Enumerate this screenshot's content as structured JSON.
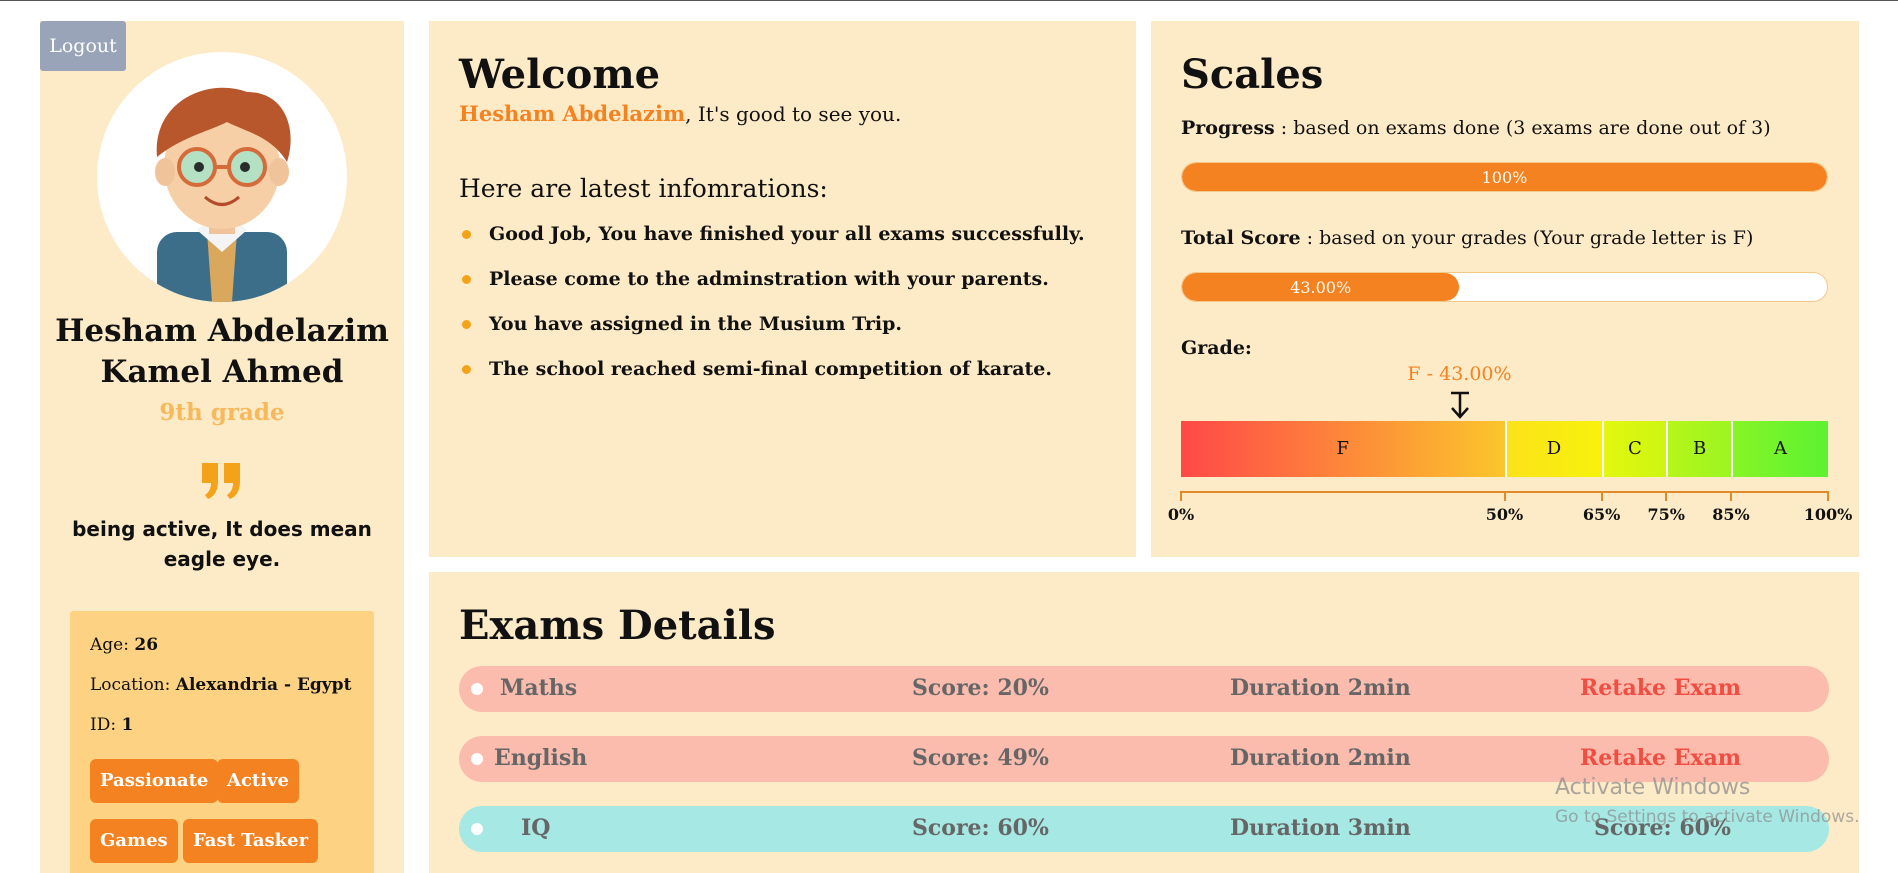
{
  "sidebar": {
    "logout_label": "Logout",
    "name": "Hesham Abdelazim Kamel Ahmed",
    "grade_level": "9th grade",
    "quote": "being active, It does mean eagle eye.",
    "info": {
      "age_label": "Age:",
      "age": "26",
      "location_label": "Location:",
      "location": "Alexandria - Egypt",
      "id_label": "ID:",
      "id": "1"
    },
    "tags": [
      "Passionate",
      "Active",
      "Games",
      "Fast Tasker"
    ]
  },
  "welcome": {
    "title": "Welcome",
    "name": "Hesham Abdelazim",
    "greeting": ", It's good to see you.",
    "subtitle": "Here are latest infomrations:",
    "items": [
      "Good Job, You have finished your all exams successfully.",
      "Please come to the adminstration with your parents.",
      "You have assigned in the Musium Trip.",
      "The school reached semi-final competition of karate."
    ]
  },
  "scales": {
    "title": "Scales",
    "progress_label": "Progress",
    "progress_desc": " : based on exams done (3 exams are done out of 3)",
    "progress_value": 100,
    "progress_text": "100%",
    "score_label": "Total Score",
    "score_desc": " : based on your grades (Your grade letter is F)",
    "score_value": 43,
    "score_text": "43.00%",
    "grade_label": "Grade:",
    "marker_text": "F - 43.00%",
    "segments": [
      {
        "letter": "F",
        "from": 0,
        "to": 50
      },
      {
        "letter": "D",
        "from": 50,
        "to": 65
      },
      {
        "letter": "C",
        "from": 65,
        "to": 75
      },
      {
        "letter": "B",
        "from": 75,
        "to": 85
      },
      {
        "letter": "A",
        "from": 85,
        "to": 100
      }
    ],
    "ticks": [
      "0%",
      "50%",
      "65%",
      "75%",
      "85%",
      "100%"
    ],
    "tick_values": [
      0,
      50,
      65,
      75,
      85,
      100
    ]
  },
  "exams": {
    "title": "Exams Details",
    "rows": [
      {
        "name": "Maths",
        "score": "Score: 20%",
        "duration": "Duration 2min",
        "action": "Retake Exam",
        "status": "fail",
        "color": "#fbbcae"
      },
      {
        "name": "English",
        "score": "Score: 49%",
        "duration": "Duration 2min",
        "action": "Retake Exam",
        "status": "fail",
        "color": "#fbbcae"
      },
      {
        "name": "IQ",
        "score": "Score: 60%",
        "duration": "Duration 3min",
        "action": "Score: 60%",
        "status": "pass",
        "color": "#a6e8e3"
      }
    ]
  },
  "watermark": {
    "line1": "Activate Windows",
    "line2": "Go to Settings to activate Windows."
  },
  "colors": {
    "accent": "#f58220",
    "panel": "#fdebc8",
    "card": "#fdd383"
  }
}
